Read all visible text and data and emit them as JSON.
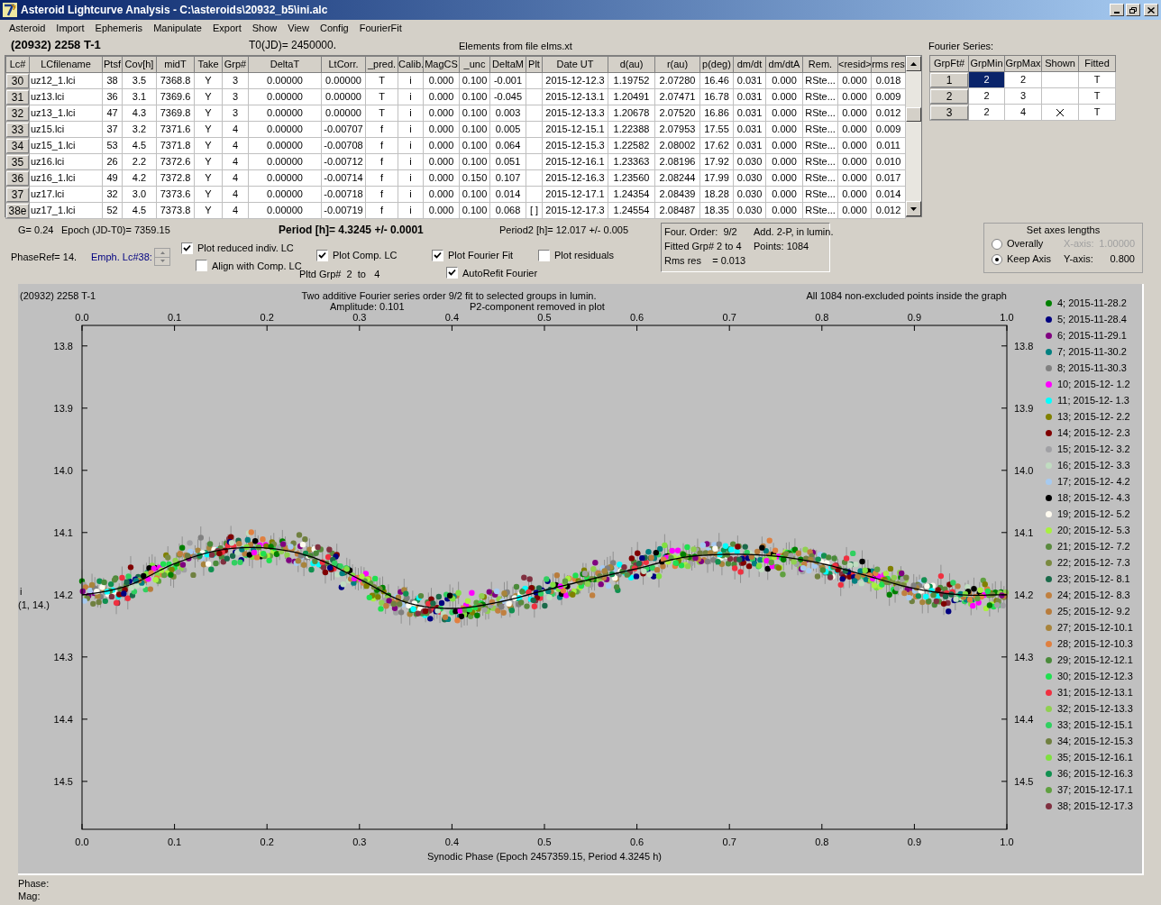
{
  "window": {
    "title": "Asteroid Lightcurve Analysis - C:\\asteroids\\20932_b5\\ini.alc"
  },
  "menu": [
    "Asteroid",
    "Import",
    "Ephemeris",
    "Manipulate",
    "Export",
    "Show",
    "View",
    "Config",
    "FourierFit"
  ],
  "header": {
    "object": "(20932) 2258 T-1",
    "t0": "T0(JD)= 2450000.",
    "elements": "Elements from file elms.xt",
    "fourier_title": "Fourier Series:"
  },
  "table": {
    "columns": [
      "Lc#",
      "LCfilename",
      "Ptsf",
      "Cov[h]",
      "midT",
      "Take",
      "Grp#",
      "DeltaT",
      "LtCorr.",
      "_pred.",
      "Calib.",
      "MagCS",
      "_unc",
      "DeltaM",
      "Plt",
      "Date UT",
      "d(au)",
      "r(au)",
      "p(deg)",
      "dm/dt",
      "dm/dtA",
      "Rem.",
      "<resid>",
      "rms res"
    ],
    "rows": [
      [
        "30",
        "uz12_1.lci",
        "38",
        "3.5",
        "7368.8",
        "Y",
        "3",
        "0.00000",
        "0.00000",
        "T",
        "i",
        "0.000",
        "0.100",
        "-0.001",
        null,
        "2015-12-12.3",
        "1.19752",
        "2.07280",
        "16.46",
        "0.031",
        "0.000",
        "RSte...",
        "0.000",
        "0.018"
      ],
      [
        "31",
        "uz13.lci",
        "36",
        "3.1",
        "7369.6",
        "Y",
        "3",
        "0.00000",
        "0.00000",
        "T",
        "i",
        "0.000",
        "0.100",
        "-0.045",
        null,
        "2015-12-13.1",
        "1.20491",
        "2.07471",
        "16.78",
        "0.031",
        "0.000",
        "RSte...",
        "0.000",
        "0.009"
      ],
      [
        "32",
        "uz13_1.lci",
        "47",
        "4.3",
        "7369.8",
        "Y",
        "3",
        "0.00000",
        "0.00000",
        "T",
        "i",
        "0.000",
        "0.100",
        "0.003",
        null,
        "2015-12-13.3",
        "1.20678",
        "2.07520",
        "16.86",
        "0.031",
        "0.000",
        "RSte...",
        "0.000",
        "0.012"
      ],
      [
        "33",
        "uz15.lci",
        "37",
        "3.2",
        "7371.6",
        "Y",
        "4",
        "0.00000",
        "-0.00707",
        "f",
        "i",
        "0.000",
        "0.100",
        "0.005",
        null,
        "2015-12-15.1",
        "1.22388",
        "2.07953",
        "17.55",
        "0.031",
        "0.000",
        "RSte...",
        "0.000",
        "0.009"
      ],
      [
        "34",
        "uz15_1.lci",
        "53",
        "4.5",
        "7371.8",
        "Y",
        "4",
        "0.00000",
        "-0.00708",
        "f",
        "i",
        "0.000",
        "0.100",
        "0.064",
        null,
        "2015-12-15.3",
        "1.22582",
        "2.08002",
        "17.62",
        "0.031",
        "0.000",
        "RSte...",
        "0.000",
        "0.011"
      ],
      [
        "35",
        "uz16.lci",
        "26",
        "2.2",
        "7372.6",
        "Y",
        "4",
        "0.00000",
        "-0.00712",
        "f",
        "i",
        "0.000",
        "0.100",
        "0.051",
        null,
        "2015-12-16.1",
        "1.23363",
        "2.08196",
        "17.92",
        "0.030",
        "0.000",
        "RSte...",
        "0.000",
        "0.010"
      ],
      [
        "36",
        "uz16_1.lci",
        "49",
        "4.2",
        "7372.8",
        "Y",
        "4",
        "0.00000",
        "-0.00714",
        "f",
        "i",
        "0.000",
        "0.150",
        "0.107",
        null,
        "2015-12-16.3",
        "1.23560",
        "2.08244",
        "17.99",
        "0.030",
        "0.000",
        "RSte...",
        "0.000",
        "0.017"
      ],
      [
        "37",
        "uz17.lci",
        "32",
        "3.0",
        "7373.6",
        "Y",
        "4",
        "0.00000",
        "-0.00718",
        "f",
        "i",
        "0.000",
        "0.100",
        "0.014",
        null,
        "2015-12-17.1",
        "1.24354",
        "2.08439",
        "18.28",
        "0.030",
        "0.000",
        "RSte...",
        "0.000",
        "0.014"
      ],
      [
        "38e",
        "uz17_1.lci",
        "52",
        "4.5",
        "7373.8",
        "Y",
        "4",
        "0.00000",
        "-0.00719",
        "f",
        "i",
        "0.000",
        "0.100",
        "0.068",
        "[ ]",
        "2015-12-17.3",
        "1.24554",
        "2.08487",
        "18.35",
        "0.030",
        "0.000",
        "RSte...",
        "0.000",
        "0.012"
      ]
    ]
  },
  "fourier_series": {
    "columns": [
      "GrpFt#",
      "GrpMin",
      "GrpMax",
      "Shown",
      "Fitted"
    ],
    "rows": [
      {
        "grpft": "1",
        "grpmin": "2",
        "grpmax": "2",
        "shown": false,
        "fitted": "T",
        "selected": true
      },
      {
        "grpft": "2",
        "grpmin": "2",
        "grpmax": "3",
        "shown": false,
        "fitted": "T",
        "selected": false
      },
      {
        "grpft": "3",
        "grpmin": "2",
        "grpmax": "4",
        "shown": true,
        "fitted": "T",
        "selected": false
      }
    ]
  },
  "stats": {
    "g": "G= 0.24",
    "epoch": "Epoch (JD-T0)= 7359.15",
    "period": "Period [h]= 4.3245 +/- 0.0001",
    "period2": "Period2 [h]= 12.017 +/- 0.005",
    "phase_ref": "PhaseRef= 14.",
    "emph": "Emph. Lc#38:",
    "pltd_grp": "Pltd Grp#  2  to   4"
  },
  "options": [
    {
      "label": "Plot reduced indiv. LC",
      "checked": true
    },
    {
      "label": "Align with Comp. LC",
      "checked": false
    },
    {
      "label": "Plot Comp. LC",
      "checked": true
    },
    {
      "label": "Plot Fourier Fit",
      "checked": true
    },
    {
      "label": "AutoRefit Fourier",
      "checked": true
    },
    {
      "label": "Plot residuals",
      "checked": false
    }
  ],
  "fit_info": [
    "Four. Order:  9/2",
    "Add. 2-P, in lumin.",
    "Fitted Grp# 2 to 4",
    "Points: 1084",
    "Rms res    = 0.013"
  ],
  "axes_box": {
    "title": "Set axes lengths",
    "modes": [
      {
        "label": "Overally",
        "selected": false
      },
      {
        "label": "Keep Axis",
        "selected": true
      }
    ],
    "x_axis": {
      "label": "X-axis:",
      "value": "1.00000",
      "disabled": true
    },
    "y_axis": {
      "label": "Y-axis:",
      "value": "0.800",
      "disabled": false
    }
  },
  "plot": {
    "object": "(20932) 2258 T-1",
    "title": "Two additive Fourier series order 9/2 fit to selected groups in lumin.",
    "amplitude": "Amplitude: 0.101",
    "p2_note": "P2-component removed in plot",
    "points_note": "All 1084 non-excluded points inside the graph",
    "y_caption": [
      "i",
      "(1, 14.)"
    ],
    "top_axis_labels": [
      "0.0",
      "0.1",
      "0.2",
      "0.3",
      "0.4",
      "0.5",
      "0.6",
      "0.7",
      "0.8",
      "0.9",
      "1.0"
    ],
    "right_axis_labels": [
      "13.8",
      "13.9",
      "14.0",
      "14.1",
      "14.2",
      "14.3",
      "14.4",
      "14.5"
    ],
    "chart_data": {
      "type": "line",
      "xlabel": "Synodic Phase (Epoch 2457359.15, Period 4.3245 h)",
      "x": [
        0,
        0.05,
        0.1,
        0.15,
        0.2,
        0.25,
        0.3,
        0.35,
        0.4,
        0.45,
        0.5,
        0.55,
        0.6,
        0.65,
        0.7,
        0.75,
        0.8,
        0.85,
        0.9,
        0.95,
        1
      ],
      "series": [
        {
          "color": "#000000",
          "values": [
            14.2,
            14.185,
            14.15,
            14.128,
            14.125,
            14.14,
            14.175,
            14.212,
            14.222,
            14.212,
            14.193,
            14.175,
            14.158,
            14.14,
            14.135,
            14.138,
            14.15,
            14.17,
            14.19,
            14.2,
            14.2
          ]
        }
      ],
      "xlim": [
        0,
        1
      ],
      "ylim": [
        14.577,
        13.767
      ],
      "xticks": [
        {
          "value": 0,
          "label": "0.0"
        },
        {
          "value": 0.1,
          "label": "0.1"
        },
        {
          "value": 0.2,
          "label": "0.2"
        },
        {
          "value": 0.3,
          "label": "0.3"
        },
        {
          "value": 0.4,
          "label": "0.4"
        },
        {
          "value": 0.5,
          "label": "0.5"
        },
        {
          "value": 0.6,
          "label": "0.6"
        },
        {
          "value": 0.7,
          "label": "0.7"
        },
        {
          "value": 0.8,
          "label": "0.8"
        },
        {
          "value": 0.9,
          "label": "0.9"
        },
        {
          "value": 1,
          "label": "1.0"
        }
      ],
      "yticks": [
        13.8,
        13.9,
        {
          "value": 14,
          "label": "14.0"
        },
        14.1,
        14.2,
        14.3,
        14.4,
        14.5
      ]
    },
    "legend": [
      {
        "label": "4; 2015-11-28.2",
        "color": "#008000"
      },
      {
        "label": "5; 2015-11-28.4",
        "color": "#000080"
      },
      {
        "label": "6; 2015-11-29.1",
        "color": "#800080"
      },
      {
        "label": "7; 2015-11-30.2",
        "color": "#008080"
      },
      {
        "label": "8; 2015-11-30.3",
        "color": "#808080"
      },
      {
        "label": "10; 2015-12- 1.2",
        "color": "#ff00ff"
      },
      {
        "label": "11; 2015-12- 1.3",
        "color": "#00ffff"
      },
      {
        "label": "13; 2015-12- 2.2",
        "color": "#808000"
      },
      {
        "label": "14; 2015-12- 2.3",
        "color": "#800000"
      },
      {
        "label": "15; 2015-12- 3.2",
        "color": "#a0a0a4"
      },
      {
        "label": "16; 2015-12- 3.3",
        "color": "#c0dcc0"
      },
      {
        "label": "17; 2015-12- 4.2",
        "color": "#a6caf0"
      },
      {
        "label": "18; 2015-12- 4.3",
        "color": "#000000"
      },
      {
        "label": "19; 2015-12- 5.2",
        "color": "#fffbf0"
      },
      {
        "label": "20; 2015-12- 5.3",
        "color": "#a8f040"
      },
      {
        "label": "21; 2015-12- 7.2",
        "color": "#5a8a3e"
      },
      {
        "label": "22; 2015-12- 7.3",
        "color": "#7a8a40"
      },
      {
        "label": "23; 2015-12- 8.1",
        "color": "#1a6a4a"
      },
      {
        "label": "24; 2015-12- 8.3",
        "color": "#c08040"
      },
      {
        "label": "25; 2015-12- 9.2",
        "color": "#b87c3c"
      },
      {
        "label": "27; 2015-12-10.1",
        "color": "#a8843c"
      },
      {
        "label": "28; 2015-12-10.3",
        "color": "#e08040"
      },
      {
        "label": "29; 2015-12-12.1",
        "color": "#4a8a3a"
      },
      {
        "label": "30; 2015-12-12.3",
        "color": "#20e050"
      },
      {
        "label": "31; 2015-12-13.1",
        "color": "#f03040"
      },
      {
        "label": "32; 2015-12-13.3",
        "color": "#90d050"
      },
      {
        "label": "33; 2015-12-15.1",
        "color": "#30d060"
      },
      {
        "label": "34; 2015-12-15.3",
        "color": "#708040"
      },
      {
        "label": "35; 2015-12-16.1",
        "color": "#80e040"
      },
      {
        "label": "36; 2015-12-16.3",
        "color": "#109050"
      },
      {
        "label": "37; 2015-12-17.1",
        "color": "#60a040"
      },
      {
        "label": "38; 2015-12-17.3",
        "color": "#803040"
      }
    ]
  },
  "status": [
    "Phase:",
    "Mag:"
  ]
}
